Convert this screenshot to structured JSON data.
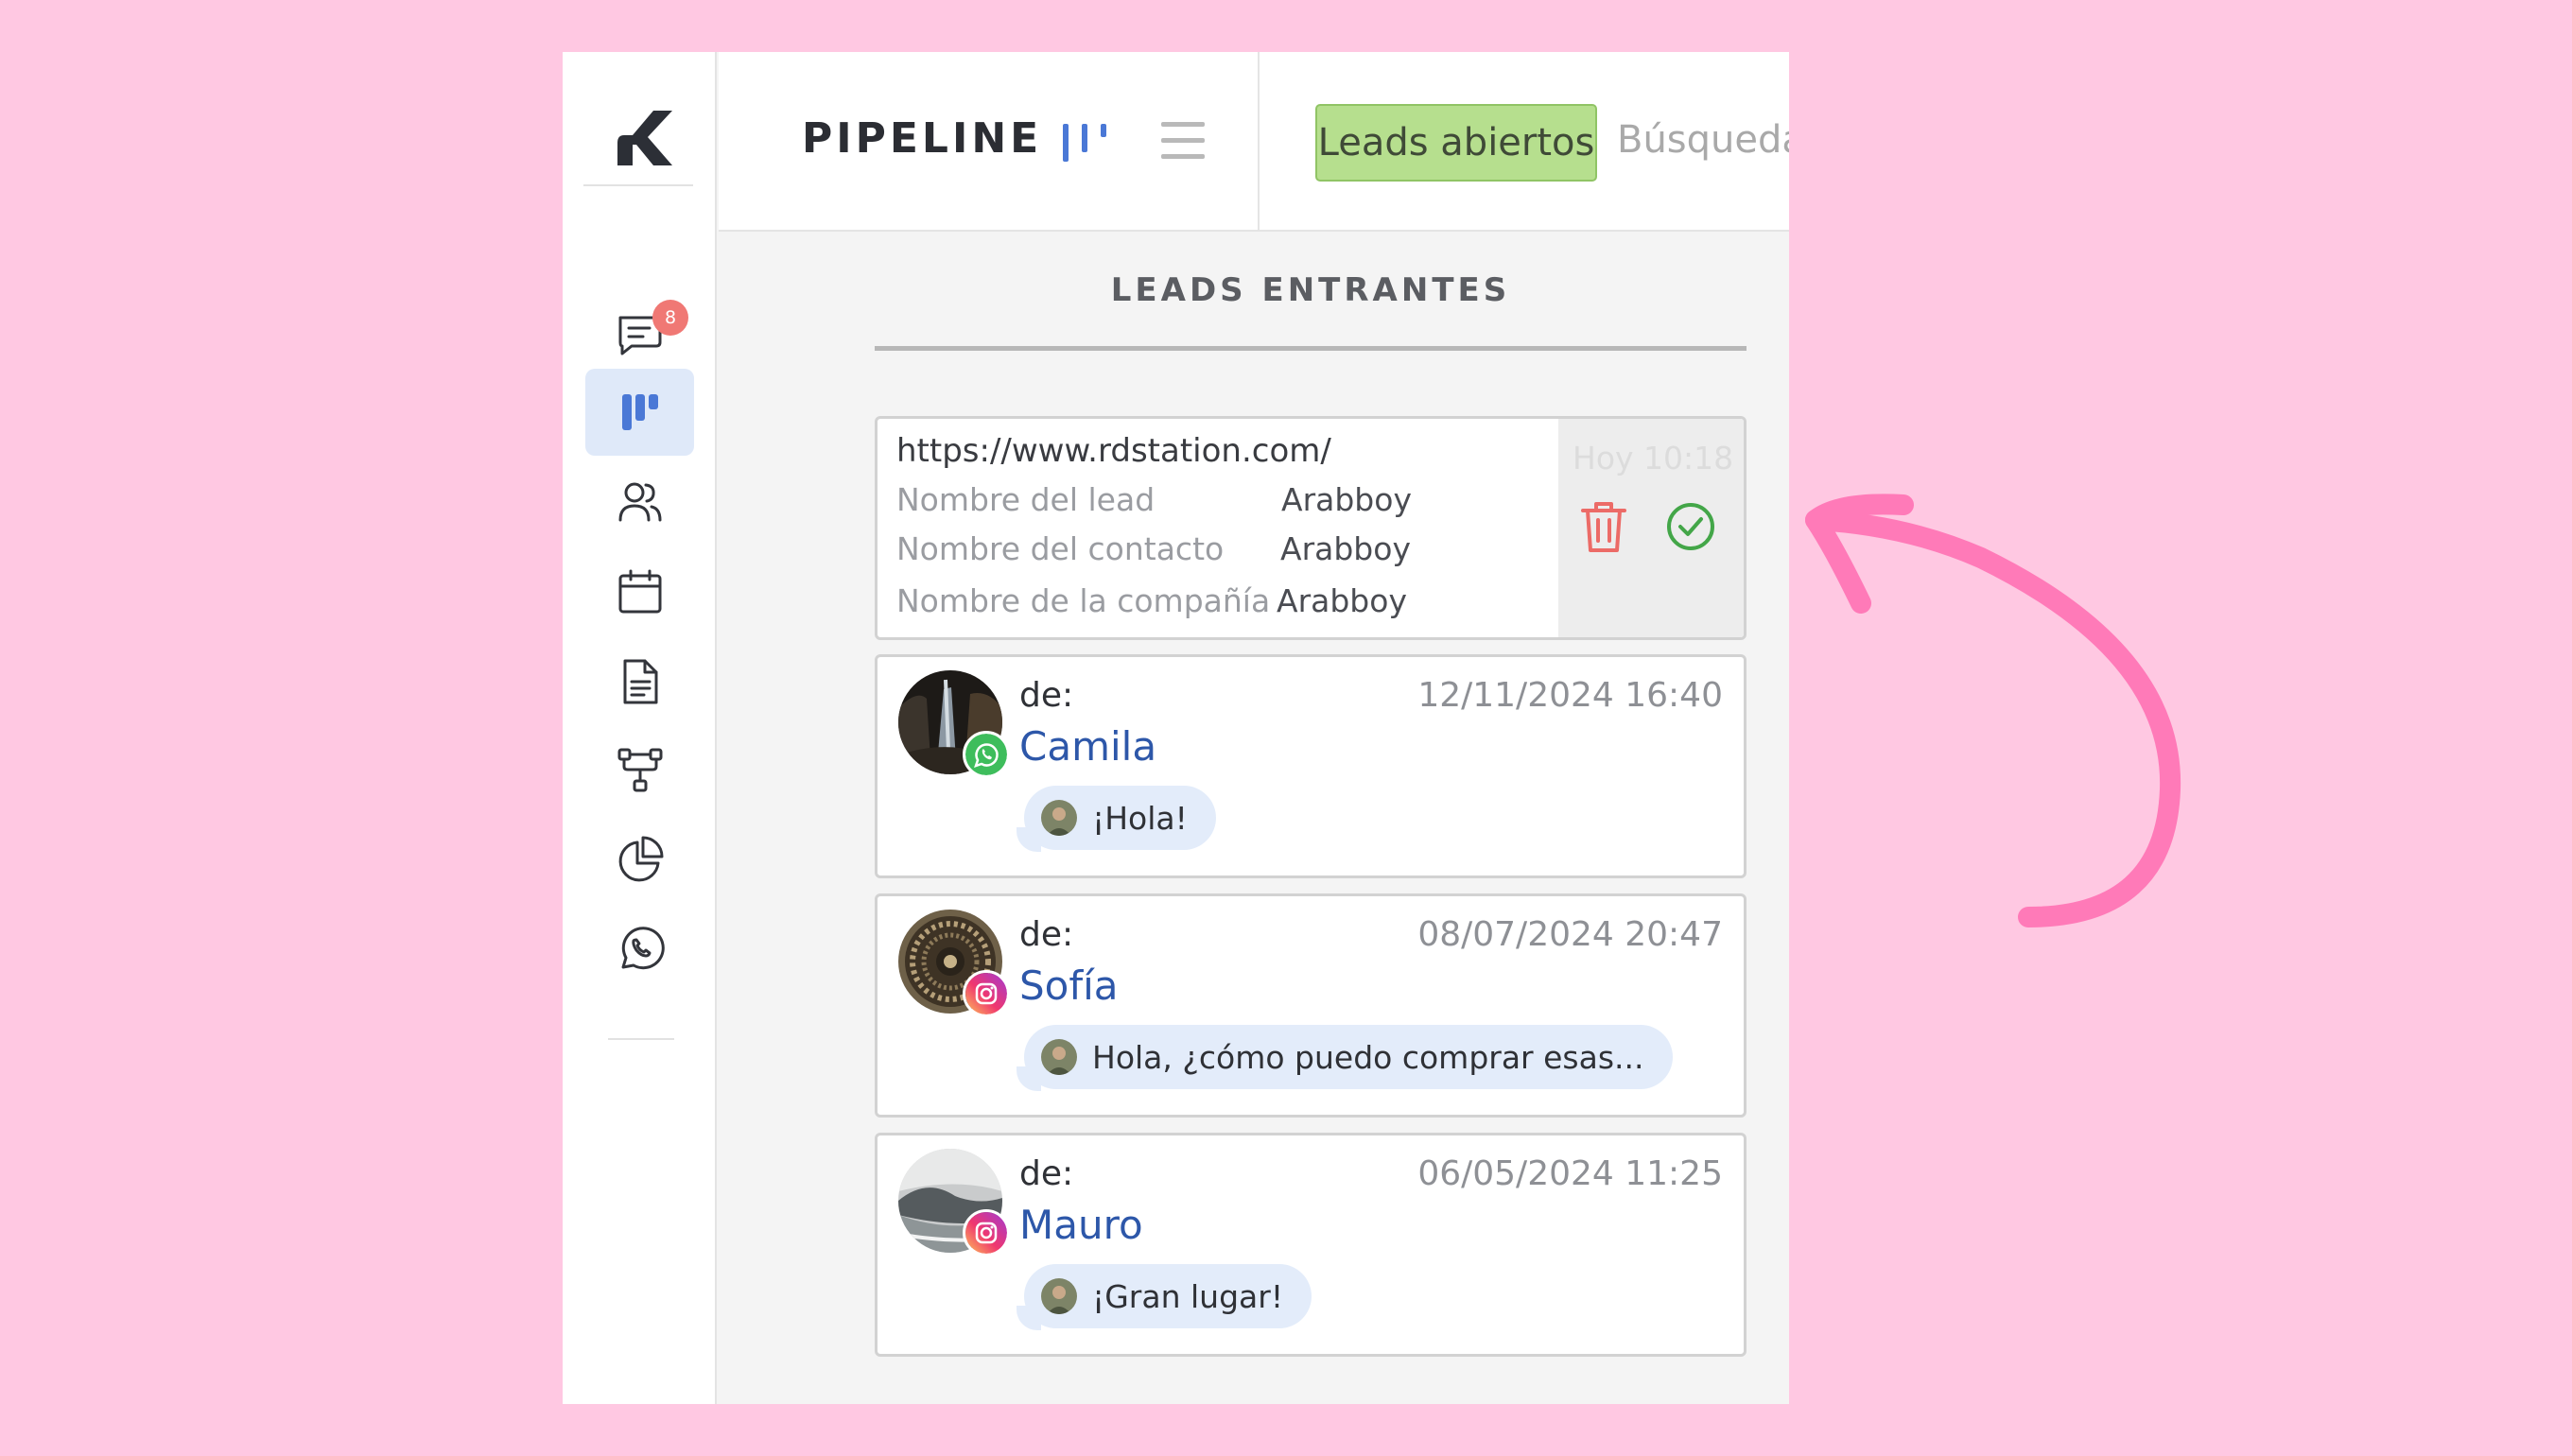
{
  "app": {
    "logo": "K"
  },
  "sidebar": {
    "items": [
      {
        "icon": "chat-icon",
        "badge": "8",
        "active": false
      },
      {
        "icon": "kanban-icon",
        "active": true
      },
      {
        "icon": "users-icon",
        "active": false
      },
      {
        "icon": "calendar-icon",
        "active": false
      },
      {
        "icon": "document-icon",
        "active": false
      },
      {
        "icon": "flow-icon",
        "active": false
      },
      {
        "icon": "pie-chart-icon",
        "active": false
      },
      {
        "icon": "whatsapp-icon",
        "active": false
      }
    ]
  },
  "header": {
    "title": "PIPELINE",
    "tabs": {
      "active": "Leads abiertos",
      "next": "Búsqueda"
    }
  },
  "column": {
    "title": "LEADS ENTRANTES",
    "lead": {
      "url": "https://www.rdstation.com/",
      "time": "Hoy 10:18",
      "fields": [
        {
          "label": "Nombre del lead",
          "value": "Arabboy"
        },
        {
          "label": "Nombre del contacto",
          "value": "Arabboy"
        },
        {
          "label": "Nombre de la compañía",
          "value": "Arabboy"
        }
      ]
    },
    "messages": [
      {
        "from_label": "de:",
        "name": "Camila",
        "date": "12/11/2024 16:40",
        "text": "¡Hola!",
        "channel": "whatsapp-icon"
      },
      {
        "from_label": "de:",
        "name": "Sofía",
        "date": "08/07/2024 20:47",
        "text": "Hola, ¿cómo puedo comprar esas...",
        "channel": "instagram-icon"
      },
      {
        "from_label": "de:",
        "name": "Mauro",
        "date": "06/05/2024 11:25",
        "text": "¡Gran lugar!",
        "channel": "instagram-icon"
      }
    ]
  },
  "colors": {
    "background": "#ffc8e2",
    "accent": "#4a78d6",
    "active_tab": "#b6df8e",
    "badge": "#f07874",
    "arrow": "#ff7ab8",
    "contact_name": "#2d57a9"
  }
}
